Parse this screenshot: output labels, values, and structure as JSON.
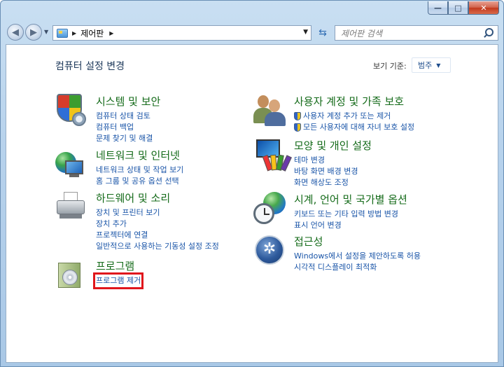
{
  "window": {
    "controls": {
      "minimize": "—",
      "maximize": "□",
      "close": "✕"
    }
  },
  "nav": {
    "back": "◀",
    "forward": "▶",
    "dropdown": "▼",
    "address_text": "제어판",
    "address_sep": "▶",
    "address_sep2": "▶",
    "address_dropdown": "▼",
    "refresh": "⇆",
    "search_placeholder": "제어판 검색"
  },
  "content": {
    "heading": "컴퓨터 설정 변경",
    "view_by_label": "보기 기준:",
    "view_by_value": "범주",
    "view_by_caret": "▼"
  },
  "categories": [
    {
      "title": "시스템 및 보안",
      "icon": "shield-icon",
      "links": [
        "컴퓨터 상태 검토",
        "컴퓨터 백업",
        "문제 찾기 및 해결"
      ]
    },
    {
      "title": "네트워크 및 인터넷",
      "icon": "network-icon",
      "links": [
        "네트워크 상태 및 작업 보기",
        "홈 그룹 및 공유 옵션 선택"
      ]
    },
    {
      "title": "하드웨어 및 소리",
      "icon": "printer-icon",
      "links": [
        "장치 및 프린터 보기",
        "장치 추가",
        "프로젝터에 연결",
        "일반적으로 사용하는 기동성 설정 조정"
      ]
    },
    {
      "title": "프로그램",
      "icon": "programs-icon",
      "links": [
        "프로그램 제거"
      ]
    },
    {
      "title": "사용자 계정 및 가족 보호",
      "icon": "users-icon",
      "links": [
        "사용자 계정 추가 또는 제거",
        "모든 사용자에 대해 자녀 보호 설정"
      ]
    },
    {
      "title": "모양 및 개인 설정",
      "icon": "personalization-icon",
      "links": [
        "테마 변경",
        "바탕 화면 배경 변경",
        "화면 해상도 조정"
      ]
    },
    {
      "title": "시계, 언어 및 국가별 옵션",
      "icon": "clock-globe-icon",
      "links": [
        "키보드 또는 기타 입력 방법 변경",
        "표시 언어 변경"
      ]
    },
    {
      "title": "접근성",
      "icon": "accessibility-icon",
      "links": [
        "Windows에서 설정을 제안하도록 허용",
        "시각적 디스플레이 최적화"
      ]
    }
  ],
  "colors": {
    "category_title": "#156b1a",
    "link": "#1a55a8",
    "highlight": "#e0161c"
  }
}
